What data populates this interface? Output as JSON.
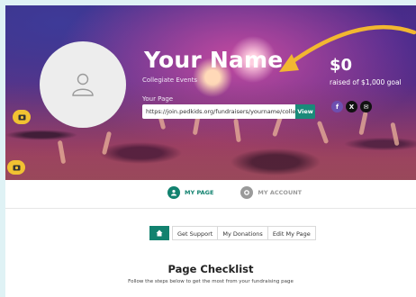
{
  "profile": {
    "name": "Your Name",
    "subtitle": "Collegiate Events",
    "page_label": "Your Page",
    "url": "https://join.pedkids.org/fundraisers/yourname/collegiate-",
    "view_label": "View"
  },
  "stats": {
    "amount": "$0",
    "goal_text": "raised of $1,000 goal"
  },
  "social": {
    "facebook": "f",
    "x": "X",
    "email": "✉"
  },
  "page_tabs": {
    "my_page": "MY PAGE",
    "my_account": "MY ACCOUNT"
  },
  "nav": {
    "get_support": "Get Support",
    "my_donations": "My Donations",
    "edit_page": "Edit My Page"
  },
  "checklist": {
    "title": "Page Checklist",
    "subtitle": "Follow the steps below to get the most from your fundraising page"
  },
  "colors": {
    "teal": "#12826f",
    "arrow": "#f2b730",
    "camera": "#f1c232"
  },
  "icons": [
    "user-placeholder-icon",
    "camera-icon",
    "arrow-annotation-icon",
    "facebook-icon",
    "x-icon",
    "email-icon",
    "home-icon",
    "user-circle-icon",
    "gear-icon"
  ]
}
